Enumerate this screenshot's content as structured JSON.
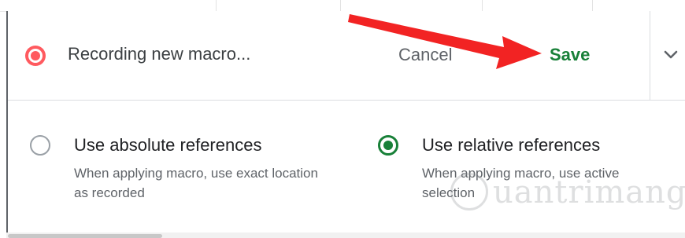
{
  "header": {
    "recording_label": "Recording new macro...",
    "cancel_label": "Cancel",
    "save_label": "Save"
  },
  "options": {
    "absolute": {
      "title": "Use absolute references",
      "description": "When applying macro, use exact location as recorded",
      "selected": false
    },
    "relative": {
      "title": "Use relative references",
      "description": "When applying macro, use active selection",
      "selected": true
    }
  },
  "watermark": {
    "text": "uantrimang"
  },
  "colors": {
    "save_green": "#188038",
    "record_red": "#ff5a5f",
    "annotation_arrow": "#f22323"
  },
  "icons": {
    "record": "record-dot-icon",
    "dropdown": "chevron-down-icon"
  }
}
